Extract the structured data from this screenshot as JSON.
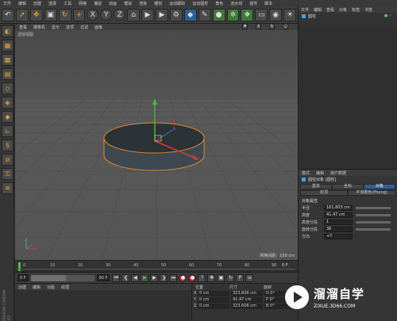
{
  "menubar": [
    "文件",
    "编辑",
    "创建",
    "选择",
    "工具",
    "网格",
    "捕捉",
    "动画",
    "模拟",
    "渲染",
    "雕刻",
    "运动跟踪",
    "运动图形",
    "角色",
    "流水线",
    "插件",
    "脚本",
    "窗口",
    "帮助"
  ],
  "toolbar": {
    "tools": [
      "undo-icon",
      "pointer-icon",
      "move-icon",
      "scale-icon",
      "rotate-icon",
      "x-axis",
      "y-axis",
      "z-axis",
      "coord-icon",
      "render-region-icon",
      "render-view-icon",
      "render-settings-icon",
      "cube-icon",
      "pen-icon",
      "subdivide-icon",
      "array-icon",
      "deformer-icon",
      "floor-icon",
      "camera-icon",
      "light-icon"
    ],
    "axis_labels": [
      "X",
      "Y",
      "Z"
    ]
  },
  "left_tools": [
    "make-editable-icon",
    "model-mode-icon",
    "texture-mode-icon",
    "workplane-icon",
    "points-mode-icon",
    "edges-mode-icon",
    "polygons-mode-icon",
    "axis-mode-icon",
    "snap-icon",
    "quantize-icon",
    "lock-icon",
    "layer-icon"
  ],
  "viewport": {
    "menu": [
      "查看",
      "摄像机",
      "显示",
      "选项",
      "过滤",
      "面板"
    ],
    "label": "透视视图",
    "grid_text": "网格间距：100 cm"
  },
  "timeline": {
    "ticks": [
      "0",
      "10",
      "20",
      "30",
      "40",
      "50",
      "60",
      "70",
      "80",
      "90"
    ],
    "current_frame": "0 F"
  },
  "transport": {
    "start_field": "0 F",
    "slider_value": "90 F",
    "end_field": "90 F",
    "slider_fraction": 0.56
  },
  "materials": {
    "menu": [
      "创建",
      "编辑",
      "功能",
      "纹理"
    ]
  },
  "coordinates": {
    "headers": [
      "位置",
      "尺寸",
      "旋转"
    ],
    "rows": [
      {
        "axis": "X",
        "pos": "0 cm",
        "size": "323.606 cm",
        "rot": "H 0°"
      },
      {
        "axis": "Y",
        "pos": "0 cm",
        "size": "41.47 cm",
        "rot": "P 0°"
      },
      {
        "axis": "Z",
        "pos": "0 cm",
        "size": "323.606 cm",
        "rot": "B 0°"
      }
    ]
  },
  "object_manager": {
    "menu": [
      "文件",
      "编辑",
      "查看",
      "对象",
      "标签",
      "书签"
    ],
    "objects": [
      {
        "name": "圆柱"
      }
    ]
  },
  "attributes": {
    "menu": [
      "模式",
      "编辑",
      "用户数据"
    ],
    "title": "圆柱对象 [圆柱]",
    "tabs": [
      "基本",
      "坐标",
      "对象"
    ],
    "tabs2": [
      "封顶",
      "平滑着色(Phong)"
    ],
    "section": "对象属性",
    "props": [
      {
        "label": "半径",
        "value": "161.803 cm"
      },
      {
        "label": "高度",
        "value": "41.47 cm"
      },
      {
        "label": "高度分段",
        "value": "1"
      },
      {
        "label": "旋转分段",
        "value": "36"
      },
      {
        "label": "方向",
        "value": "+Y"
      }
    ]
  },
  "brand": "MAXON CINEMA 4D",
  "watermark": {
    "cn": "溜溜自学",
    "url": "ZIXUE.3D66.COM"
  },
  "colors": {
    "accent_blue": "#2f5f9a",
    "selection_orange": "#e08a30",
    "axis_red": "#d23a3a",
    "axis_green": "#3fc04a",
    "axis_blue": "#3a7ae0"
  }
}
